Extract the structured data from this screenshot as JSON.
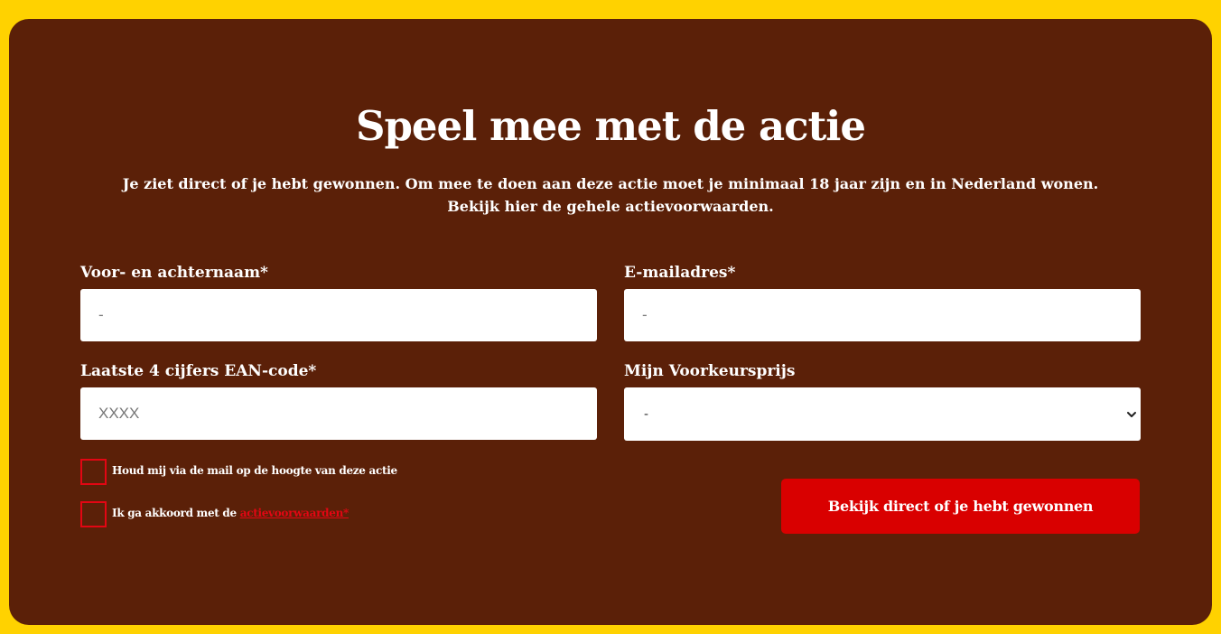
{
  "colors": {
    "page_background": "#ffd200",
    "card_background": "#5b2008",
    "accent_red": "#d90000",
    "checkbox_border": "#e30613",
    "text_light": "#ffffff"
  },
  "form": {
    "title": "Speel mee met de actie",
    "intro": "Je ziet direct of je hebt gewonnen. Om mee te doen aan deze actie moet je minimaal 18 jaar zijn en in Nederland wonen. Bekijk hier de gehele actievoorwaarden.",
    "name": {
      "label": "Voor- en achternaam*",
      "placeholder": "-",
      "value": ""
    },
    "email": {
      "label": "E-mailadres*",
      "placeholder": "-",
      "value": ""
    },
    "ean": {
      "label": "Laatste 4 cijfers EAN-code*",
      "placeholder": "XXXX",
      "value": ""
    },
    "prize": {
      "label": "Mijn Voorkeursprijs",
      "selected": "-",
      "chevron_icon": "chevron-down-icon"
    },
    "newsletter_checkbox": {
      "label": "Houd mij via de mail op de hoogte van deze actie",
      "checked": false
    },
    "terms_checkbox": {
      "label_prefix": "Ik ga akkoord met de ",
      "link_text": "actievoorwaarden*",
      "checked": false
    },
    "submit_label": "Bekijk direct of je hebt gewonnen"
  }
}
